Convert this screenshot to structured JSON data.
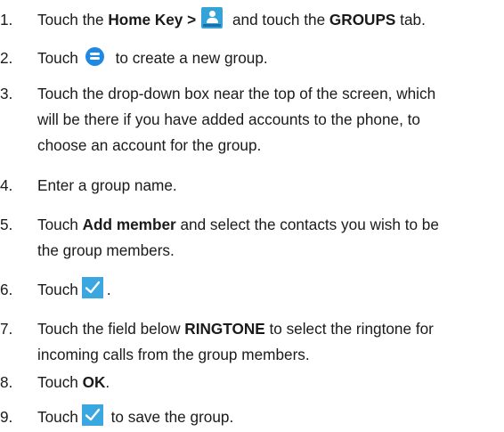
{
  "steps": [
    {
      "num": "1.",
      "t1": "Touch the ",
      "b1": "Home Key >",
      "t2": " and touch the ",
      "b2": "GROUPS",
      "t3": " tab.",
      "icon": "contacts-app-icon"
    },
    {
      "num": "2.",
      "t1": "Touch",
      "t2": " to create a new group.",
      "icon": "add-group-icon"
    },
    {
      "num": "3.",
      "l1": "Touch the drop-down box near the top of the screen, which",
      "l2": "will be there if you have added accounts to the phone, to",
      "l3": "choose an account for the group."
    },
    {
      "num": "4.",
      "t1": "Enter a group name."
    },
    {
      "num": "5.",
      "t1": "Touch ",
      "b1": "Add member",
      "t2": " and select the contacts you wish to be",
      "l2": "the group members."
    },
    {
      "num": "6.",
      "t1": "Touch",
      "t2": ".",
      "icon": "checkmark-icon"
    },
    {
      "num": "7.",
      "t1": "Touch the field below ",
      "b1": "RINGTONE",
      "t2": " to select the ringtone for",
      "l2": "incoming calls from the group members."
    },
    {
      "num": "8.",
      "t1": "Touch ",
      "b1": "OK",
      "t2": "."
    },
    {
      "num": "9.",
      "t1": "Touch",
      "t2": " to save the group.",
      "icon": "checkmark-icon"
    }
  ],
  "colors": {
    "text": "#1a1a1a",
    "icon_blue": "#3aa7e0",
    "contacts_icon": "#34a4d8",
    "add_group_icon": "#1e88e5"
  }
}
